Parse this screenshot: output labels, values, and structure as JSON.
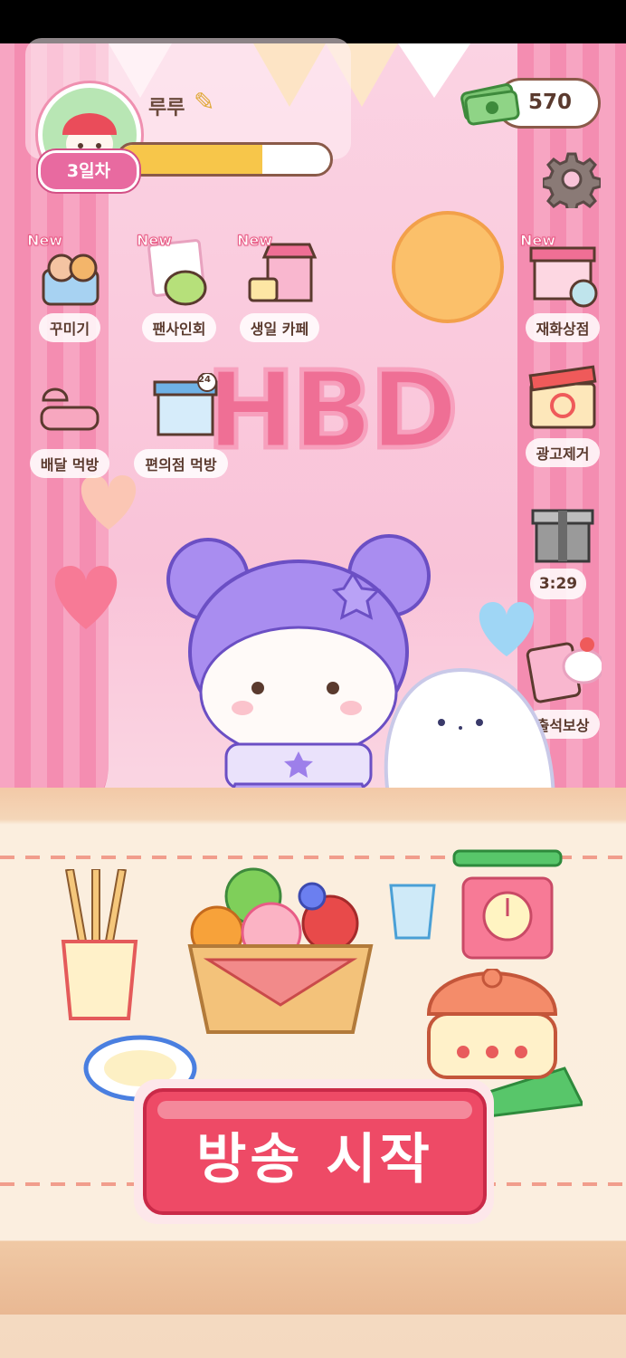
{
  "player": {
    "name": "루루",
    "day_badge": "3일차",
    "xp_progress": 0.68
  },
  "currency": {
    "amount": "570",
    "icon": "cash-icon"
  },
  "menu_left": [
    {
      "label": "꾸미기",
      "new": "New",
      "icon": "decorate-icon"
    },
    {
      "label": "팬사인회",
      "new": "New",
      "icon": "fan-sign-icon"
    },
    {
      "label": "생일 카페",
      "new": "New",
      "icon": "birthday-cafe-icon"
    },
    {
      "label": "배달 먹방",
      "icon": "delivery-mukbang-icon"
    },
    {
      "label": "편의점 먹방",
      "icon": "convenience-store-icon"
    }
  ],
  "menu_right": [
    {
      "label": "재화상점",
      "new": "New",
      "icon": "shop-icon"
    },
    {
      "label": "광고제거",
      "icon": "remove-ads-icon"
    },
    {
      "label": "출석보상",
      "icon": "attendance-reward-icon"
    }
  ],
  "gift_timer": "3:29",
  "banner_text": "HBD",
  "start_button": "방송 시작",
  "store_badge": "24",
  "colors": {
    "accent": "#ee4a66",
    "pink": "#f48db1",
    "gold": "#f7c64a"
  }
}
